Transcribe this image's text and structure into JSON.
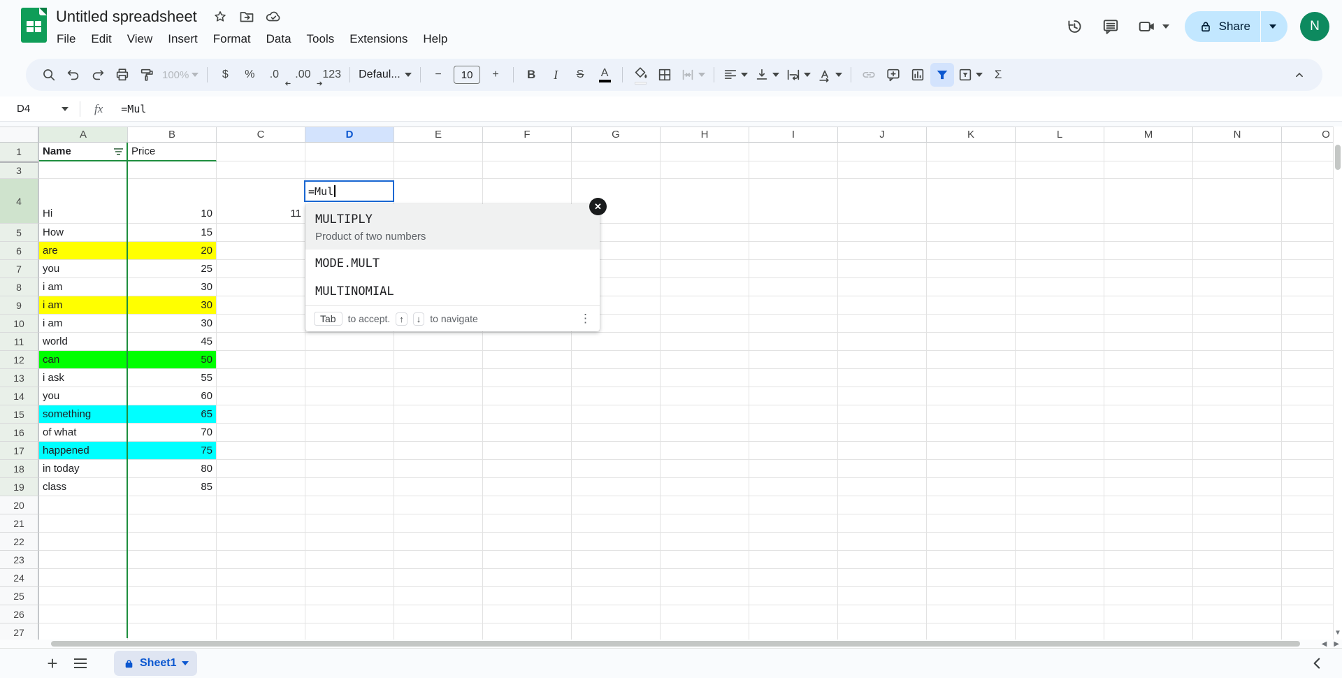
{
  "header": {
    "title": "Untitled spreadsheet",
    "menus": [
      "File",
      "Edit",
      "View",
      "Insert",
      "Format",
      "Data",
      "Tools",
      "Extensions",
      "Help"
    ],
    "share_label": "Share",
    "avatar_initial": "N"
  },
  "toolbar": {
    "zoom": "100%",
    "currency": "$",
    "percent": "%",
    "dec0": ".0",
    "dec00": ".00",
    "fmt123": "123",
    "font": "Defaul...",
    "minus": "−",
    "font_size": "10",
    "plus": "+",
    "bold": "B",
    "italic": "I",
    "strike": "S",
    "text_color": "A",
    "sigma": "Σ"
  },
  "formula_bar": {
    "cell_ref": "D4",
    "fx_label": "fx",
    "formula": "=Mul"
  },
  "grid": {
    "columns": [
      "A",
      "B",
      "C",
      "D",
      "E",
      "F",
      "G",
      "H",
      "I",
      "J",
      "K",
      "L",
      "M",
      "N",
      "O"
    ],
    "selected_column": "D",
    "filtered_column": "A",
    "rows": [
      {
        "n": "1",
        "a": "Name",
        "b": "Price",
        "header_row": true
      },
      {
        "n": "3",
        "hidden_above": true
      },
      {
        "n": "4",
        "a": "Hi",
        "b": "10",
        "c": "11",
        "tall": true,
        "selected": true
      },
      {
        "n": "5",
        "a": "How",
        "b": "15"
      },
      {
        "n": "6",
        "a": "are",
        "b": "20",
        "bg": "#ffff00"
      },
      {
        "n": "7",
        "a": "you",
        "b": "25"
      },
      {
        "n": "8",
        "a": "i am",
        "b": "30"
      },
      {
        "n": "9",
        "a": "i am",
        "b": "30",
        "bg": "#ffff00"
      },
      {
        "n": "10",
        "a": "i am",
        "b": "30"
      },
      {
        "n": "11",
        "a": "world",
        "b": "45"
      },
      {
        "n": "12",
        "a": "can",
        "b": "50",
        "bg": "#00ff00"
      },
      {
        "n": "13",
        "a": "i ask",
        "b": "55"
      },
      {
        "n": "14",
        "a": "you",
        "b": "60"
      },
      {
        "n": "15",
        "a": "something",
        "b": "65",
        "bg": "#00ffff"
      },
      {
        "n": "16",
        "a": "of what",
        "b": "70"
      },
      {
        "n": "17",
        "a": "happened",
        "b": "75",
        "bg": "#00ffff"
      },
      {
        "n": "18",
        "a": "in today",
        "b": "80"
      },
      {
        "n": "19",
        "a": "class",
        "b": "85"
      },
      {
        "n": "20"
      },
      {
        "n": "21"
      },
      {
        "n": "22"
      },
      {
        "n": "23"
      },
      {
        "n": "24"
      },
      {
        "n": "25"
      },
      {
        "n": "26"
      },
      {
        "n": "27"
      }
    ]
  },
  "cell_editor": {
    "value": "=Mul"
  },
  "autocomplete": {
    "items": [
      {
        "name": "MULTIPLY",
        "desc": "Product of two numbers",
        "selected": true
      },
      {
        "name": "MODE.MULT"
      },
      {
        "name": "MULTINOMIAL"
      }
    ],
    "footer": {
      "key": "Tab",
      "accept": "to accept.",
      "up": "↑",
      "down": "↓",
      "navigate": "to navigate",
      "kebab": "⋮"
    },
    "close_glyph": "✕"
  },
  "sheet_bar": {
    "sheet_name": "Sheet1"
  },
  "colors": {
    "accent_blue": "#0b57d0",
    "selected_header_blue": "#d3e3fd",
    "filter_green": "#1e8e3e",
    "highlight_yellow": "#ffff00",
    "highlight_green": "#00ff00",
    "highlight_cyan": "#00ffff",
    "share_bg": "#c2e7ff"
  }
}
